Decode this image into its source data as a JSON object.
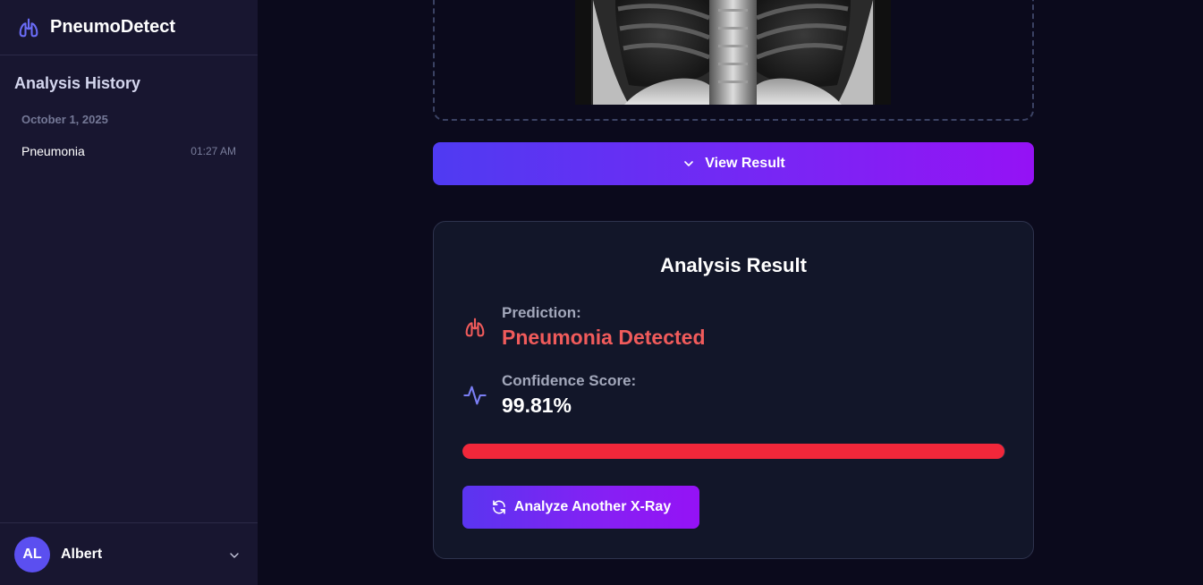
{
  "app": {
    "name": "PneumoDetect",
    "brand_icon": "lungs-icon"
  },
  "sidebar": {
    "history_title": "Analysis History",
    "groups": [
      {
        "date": "October 1, 2025",
        "items": [
          {
            "label": "Pneumonia",
            "time": "01:27 AM"
          }
        ]
      }
    ],
    "user": {
      "initials": "AL",
      "name": "Albert",
      "menu_icon": "chevron-down-icon"
    }
  },
  "upload": {
    "image": "chest-xray"
  },
  "actions": {
    "view_result_label": "View Result",
    "view_result_icon": "chevron-down-icon"
  },
  "result": {
    "title": "Analysis Result",
    "prediction_label": "Prediction:",
    "prediction_value": "Pneumonia Detected",
    "prediction_icon": "lungs-icon",
    "confidence_label": "Confidence Score:",
    "confidence_value": "99.81%",
    "confidence_fraction": 0.9981,
    "confidence_icon": "activity-icon",
    "analyze_again_label": "Analyze Another X-Ray",
    "analyze_again_icon": "refresh-icon"
  },
  "colors": {
    "accent_start": "#4f3bf2",
    "accent_end": "#9512f5",
    "danger": "#f05b5b",
    "bar_fill": "#f1273a",
    "background": "#0b0a1c",
    "sidebar": "#181630",
    "card": "#121629"
  }
}
